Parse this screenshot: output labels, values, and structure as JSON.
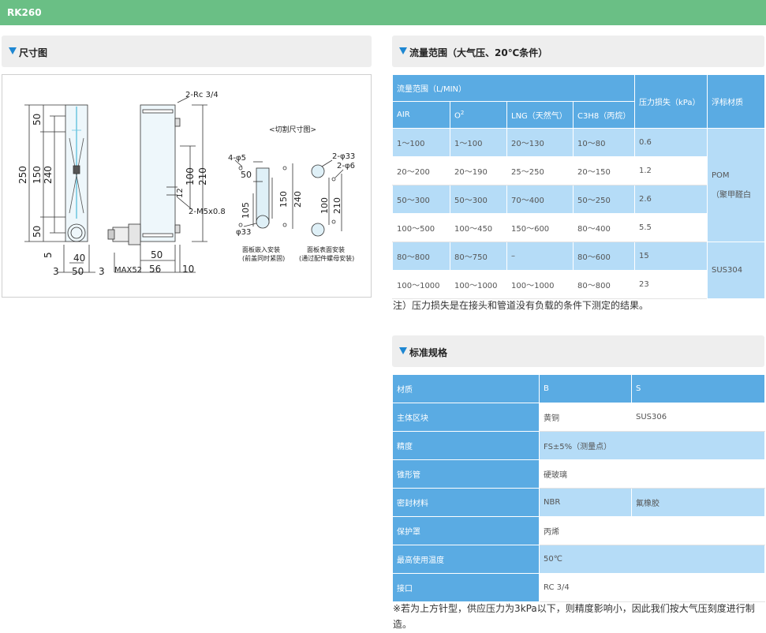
{
  "page_title": "RK260",
  "sections": {
    "dimension": "尺寸图",
    "flow": "流量范围（大气压、20℃条件）",
    "spec": "标准规格"
  },
  "diagram": {
    "dims": {
      "d50a": "50",
      "d250": "250",
      "d150": "150",
      "d240": "240",
      "d50b": "50",
      "d5": "5",
      "d40": "40",
      "d3a": "3",
      "d50c": "50",
      "d3b": "3",
      "rc": "2-Rc 3/4",
      "d100": "100",
      "d210": "210",
      "d12": "12",
      "m5": "2-M5x0.8",
      "d50d": "50",
      "max52": "MAX52",
      "d56": "56",
      "d10": "10",
      "cut_title": "<切割尺寸图>",
      "phi5": "4-φ5",
      "c50": "50",
      "c105": "105",
      "c150": "150",
      "c240": "240",
      "phi33a": "φ33",
      "phi33b": "2-φ33",
      "phi6": "2-φ6",
      "c100": "100",
      "c210": "210",
      "cap1a": "面板嵌入安装",
      "cap1b": "(前盖同时紧固)",
      "cap2a": "面板表面安装",
      "cap2b": "(通过配件螺母安装)"
    }
  },
  "flow_table": {
    "header_group": "流量范围（L/MIN）",
    "pressure_header": "压力损失（kPa）",
    "material_header": "浮标材质",
    "columns": [
      "AIR",
      "O",
      "LNG（天然气）",
      "C3H8（丙烷）"
    ],
    "o_sup": "2",
    "rows": [
      [
        "1～100",
        "1～100",
        "20～130",
        "10～80",
        "0.6"
      ],
      [
        "20～200",
        "20～190",
        "25～250",
        "20～150",
        "1.2"
      ],
      [
        "50～300",
        "50～300",
        "70～400",
        "50～250",
        "2.6"
      ],
      [
        "100～500",
        "100～450",
        "150～600",
        "80～400",
        "5.5"
      ],
      [
        "80～800",
        "80～750",
        "–",
        "80～600",
        "15"
      ],
      [
        "100～1000",
        "100～1000",
        "100～1000",
        "80～800",
        "23"
      ]
    ],
    "material_pom": "POM",
    "material_pom_sub": "（聚甲醛白",
    "material_sus": "SUS304",
    "note": "注）压力损失是在接头和管道没有负载的条件下测定的结果。"
  },
  "spec_table": {
    "rows": [
      {
        "label": "材质",
        "b": "B",
        "s": "S"
      },
      {
        "label": "主体区块",
        "b": "黄铜",
        "s": "SUS306"
      },
      {
        "label": "精度",
        "value": "FS±5%（测量点）"
      },
      {
        "label": "锥形管",
        "value": "硬玻璃"
      },
      {
        "label": "密封材料",
        "b": "NBR",
        "s": "氟橡胶"
      },
      {
        "label": "保护罩",
        "value": "丙烯"
      },
      {
        "label": "最高使用温度",
        "value": "50℃"
      },
      {
        "label": "接口",
        "value": "RC 3/4"
      }
    ],
    "note": "※若为上方针型，供应压力为3kPa以下，则精度影响小，因此我们按大气压刻度进行制造。"
  }
}
